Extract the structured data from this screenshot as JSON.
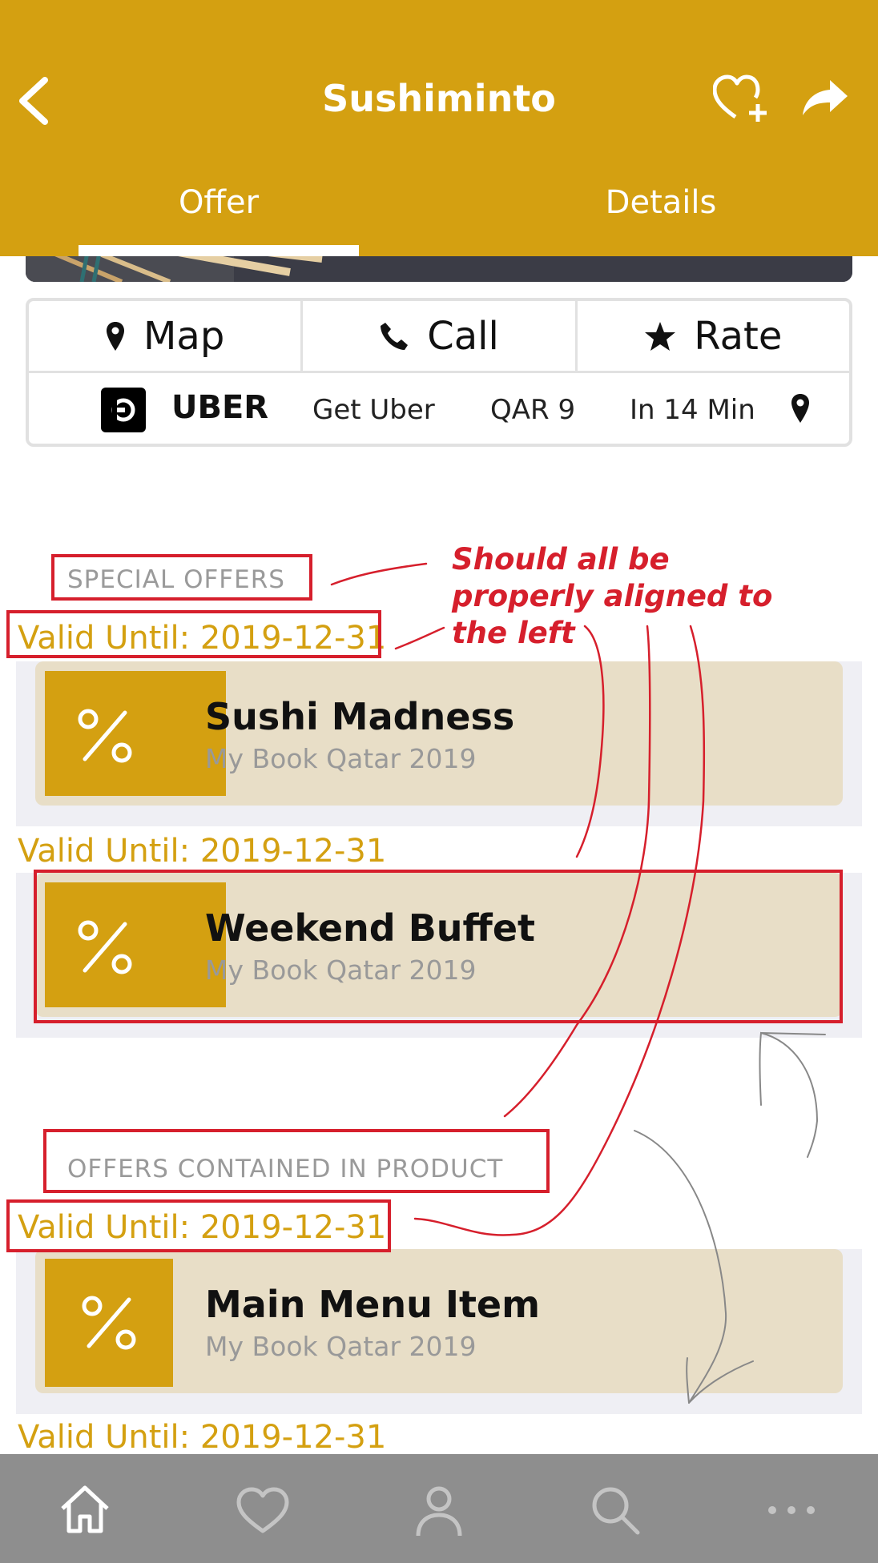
{
  "header": {
    "title": "Sushiminto",
    "tabs": [
      {
        "label": "Offer",
        "active": true
      },
      {
        "label": "Details",
        "active": false
      }
    ],
    "color": "#D4A011"
  },
  "actions": {
    "map_label": "Map",
    "call_label": "Call",
    "rate_label": "Rate",
    "uber": {
      "brand": "UBER",
      "get_label": "Get Uber",
      "price": "QAR 9",
      "eta": "In 14 Min"
    }
  },
  "special_offers": {
    "heading": "SPECIAL OFFERS",
    "items": [
      {
        "valid": "Valid Until: 2019-12-31",
        "title": "Sushi Madness",
        "subtitle": "My Book Qatar 2019"
      },
      {
        "valid": "Valid Until: 2019-12-31",
        "title": "Weekend Buffet",
        "subtitle": "My Book Qatar 2019"
      }
    ]
  },
  "product_offers": {
    "heading": "OFFERS CONTAINED IN PRODUCT",
    "items": [
      {
        "valid": "Valid Until: 2019-12-31",
        "title": "Main Menu Item",
        "subtitle": "My Book Qatar 2019"
      },
      {
        "valid": "Valid Until: 2019-12-31"
      }
    ]
  },
  "annotation": {
    "lines": [
      "Should all be",
      "properly aligned to",
      "the left"
    ],
    "color": "#d61f2c"
  },
  "tabbar": {
    "icons": [
      "home-icon",
      "heart-icon",
      "profile-icon",
      "search-icon",
      "more-icon"
    ]
  }
}
